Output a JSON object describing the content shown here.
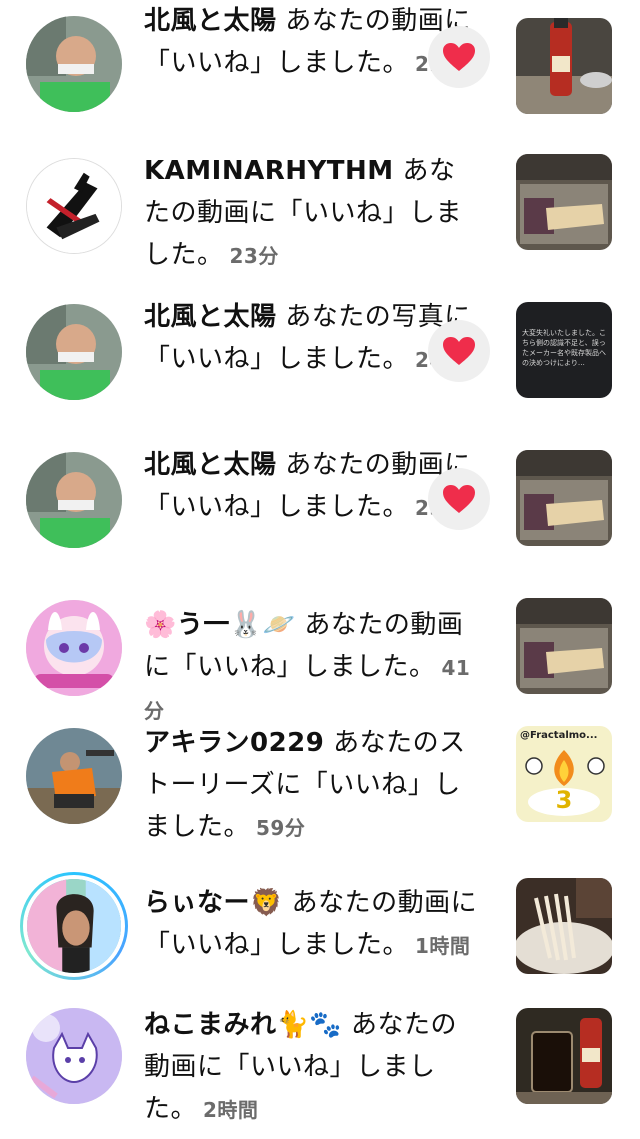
{
  "notifications": [
    {
      "user": "北風と太陽",
      "action": "あなたの動画に「いいね」しました。",
      "time": "22分",
      "liked_back": true
    },
    {
      "user": "KAMINARHYTHM",
      "action": "あなたの動画に「いいね」しました。",
      "time": "23分",
      "liked_back": false
    },
    {
      "user": "北風と太陽",
      "action": "あなたの写真に「いいね」しました。",
      "time": "24分",
      "liked_back": true
    },
    {
      "user": "北風と太陽",
      "action": "あなたの動画に「いいね」しました。",
      "time": "25分",
      "liked_back": true
    },
    {
      "user": "🌸う一🐰🪐",
      "action": "あなたの動画に「いいね」しました。",
      "time": "41分",
      "liked_back": false
    },
    {
      "user": "アキラン0229",
      "action": "あなたのストーリーズに「いいね」しました。",
      "time": "59分",
      "liked_back": false
    },
    {
      "user": "らぃなー🦁",
      "action": "あなたの動画に「いいね」しました。",
      "time": "1時間",
      "liked_back": false
    },
    {
      "user": "ねこまみれ🐈🐾",
      "action": "あなたの動画に「いいね」しました。",
      "time": "2時間",
      "liked_back": false
    }
  ],
  "thumb_texts": {
    "photo_note": "大変失礼いたしました。こちら側の認識不足と、誤ったメーカー名や既存製品への決めつけにより…",
    "fractal_tag": "@Fractalmo...",
    "fractal_num": "3"
  },
  "colors": {
    "heart": "#ef2d4b",
    "heart_bg": "#efefef",
    "time": "#6b6b6b"
  },
  "icons": {
    "heart": "heart-icon"
  }
}
